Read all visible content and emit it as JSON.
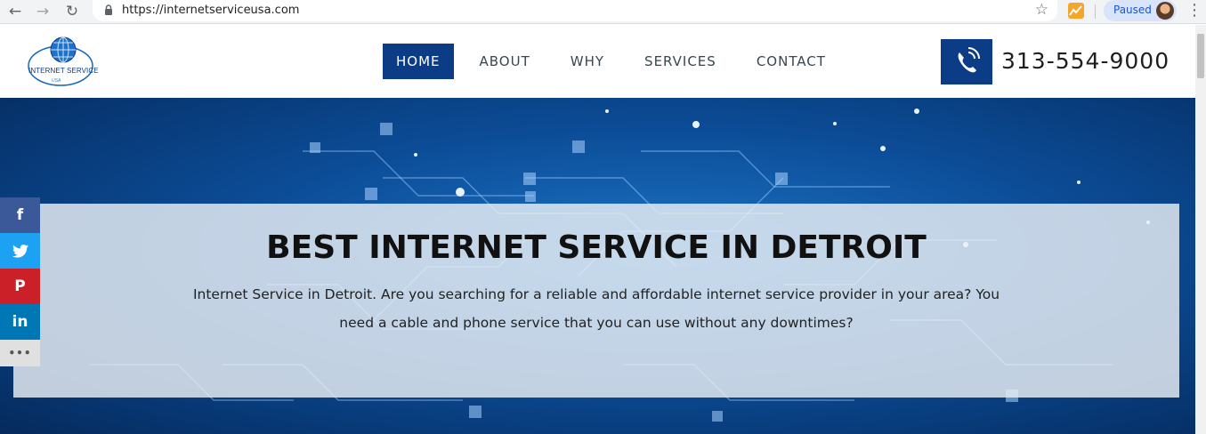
{
  "browser": {
    "url": "https://internetserviceusa.com",
    "profile_status": "Paused"
  },
  "site": {
    "logo_text": "INTERNET SERVICE",
    "logo_subtext": "USA",
    "nav": [
      {
        "label": "HOME",
        "active": true
      },
      {
        "label": "ABOUT"
      },
      {
        "label": "WHY"
      },
      {
        "label": "SERVICES"
      },
      {
        "label": "CONTACT"
      }
    ],
    "phone": "313-554-9000",
    "brand_color": "#0c3c86"
  },
  "hero": {
    "title": "BEST INTERNET SERVICE IN DETROIT",
    "text": "Internet Service in Detroit. Are you searching for a reliable and affordable internet service provider in your area? You need a cable and phone service that you can use without any downtimes?"
  },
  "share": [
    {
      "icon": "facebook-icon",
      "glyph": "f",
      "color": "#3b5998"
    },
    {
      "icon": "twitter-icon",
      "color": "#1da1f2"
    },
    {
      "icon": "pinterest-icon",
      "glyph": "P",
      "color": "#cb2027"
    },
    {
      "icon": "linkedin-icon",
      "glyph": "in",
      "color": "#0077b5"
    },
    {
      "icon": "more-icon",
      "glyph": "•••"
    }
  ]
}
